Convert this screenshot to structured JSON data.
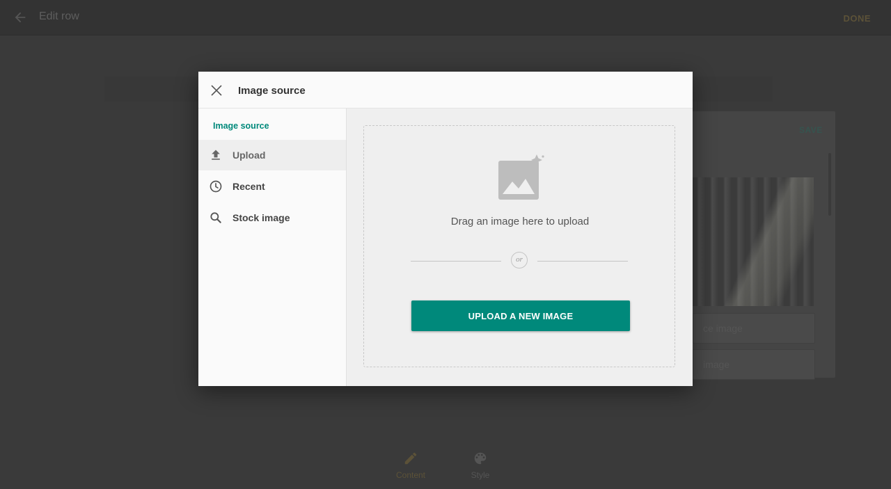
{
  "background": {
    "app_title": "Edit row",
    "done_label": "DONE",
    "panel": {
      "save_label": "SAVE",
      "buttons": [
        {
          "label": "ce image"
        },
        {
          "label": "image"
        }
      ]
    },
    "bottom_tabs": [
      {
        "label": "Content",
        "icon": "pencil-icon"
      },
      {
        "label": "Style",
        "icon": "palette-icon"
      }
    ]
  },
  "dialog": {
    "title": "Image source",
    "close_icon": "close-icon",
    "sidebar": {
      "heading": "Image source",
      "items": [
        {
          "label": "Upload",
          "icon": "upload-icon",
          "active": true
        },
        {
          "label": "Recent",
          "icon": "clock-icon",
          "active": false
        },
        {
          "label": "Stock image",
          "icon": "search-icon",
          "active": false
        }
      ]
    },
    "upload": {
      "drag_text": "Drag an image here to upload",
      "or_text": "or",
      "button_label": "UPLOAD A NEW IMAGE"
    }
  },
  "colors": {
    "accent": "#00897b",
    "overlay": "#3a3a3a",
    "dialog_bg": "#fafafa",
    "main_bg": "#efefef"
  }
}
